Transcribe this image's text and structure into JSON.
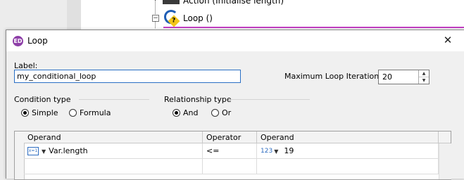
{
  "background": {
    "action_node_text": "Action (Initialise length)",
    "loop_node_text": "Loop ()",
    "expand_symbol": "−",
    "right_clipped_text": "ne"
  },
  "dialog": {
    "app_icon_text": "ED",
    "title": "Loop",
    "close_glyph": "✕",
    "label_caption": "Label:",
    "label_value": "my_conditional_loop",
    "max_iter_caption": "Maximum Loop Iterations:",
    "max_iter_value": "20",
    "condition_type": {
      "caption": "Condition type",
      "options": [
        "Simple",
        "Formula"
      ],
      "selected": "Simple"
    },
    "relationship_type": {
      "caption": "Relationship type",
      "options": [
        "And",
        "Or"
      ],
      "selected": "And"
    },
    "table": {
      "columns": [
        "Operand",
        "Operator",
        "Operand"
      ],
      "rows": [
        {
          "left_icon_text": "x=1",
          "left_operand": "Var.length",
          "operator": "<=",
          "right_icon_text": "123",
          "right_operand": "19"
        }
      ]
    }
  },
  "colors": {
    "accent_focus": "#2a6fc4",
    "app_icon": "#8e3fa8",
    "flow_highlight": "#c43fc4"
  }
}
